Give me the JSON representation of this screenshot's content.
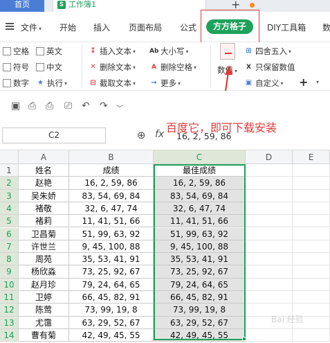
{
  "titlebar": {
    "home_tab": "首页",
    "book_icon_letter": "S",
    "book_name": "工作簿1",
    "new_tab": "+"
  },
  "menubar": {
    "file": "文件",
    "start": "开始",
    "insert": "插入",
    "page_layout": "页面布局",
    "formulas": "公式",
    "fangfang": "方方格子",
    "diy": "DIY工具箱",
    "data": "数"
  },
  "ribbon": {
    "chk_space": "空格",
    "chk_english": "英文",
    "chk_symbol": "符号",
    "chk_chinese": "中文",
    "chk_number": "数字",
    "execute": "执行",
    "insert_text": "插入文本",
    "delete_text": "删除文本",
    "cut_text": "截取文本",
    "case": "大小写",
    "delete_space": "删除空格",
    "more": "更多",
    "numeric": "数值",
    "round": "四舍五入",
    "keep_values": "只保留数值",
    "custom": "自定义",
    "plus": "+"
  },
  "formula": {
    "cell_ref": "C2",
    "value": "16, 2, 59, 86"
  },
  "annotation": "百度它，即可下载安装",
  "sheet": {
    "columns": [
      "A",
      "B",
      "C",
      "D",
      "E"
    ],
    "headers": [
      "姓名",
      "成绩",
      "最佳成绩"
    ],
    "rows": [
      {
        "n": "2",
        "name": "赵艳",
        "score": "16, 2, 59, 86",
        "best": "16, 2, 59, 86"
      },
      {
        "n": "3",
        "name": "吴朱娇",
        "score": "83, 54, 69, 84",
        "best": "83, 54, 69, 84"
      },
      {
        "n": "4",
        "name": "褚敬",
        "score": "32, 6, 47, 74",
        "best": "32, 6, 47, 74"
      },
      {
        "n": "5",
        "name": "褚莉",
        "score": "11, 41, 51, 66",
        "best": "11, 41, 51, 66"
      },
      {
        "n": "6",
        "name": "卫昌菊",
        "score": "51, 99, 63, 92",
        "best": "51, 99, 63, 92"
      },
      {
        "n": "7",
        "name": "许世兰",
        "score": "9, 45, 100, 88",
        "best": "9, 45, 100, 88"
      },
      {
        "n": "8",
        "name": "周苑",
        "score": "35, 53, 41, 91",
        "best": "35, 53, 41, 91"
      },
      {
        "n": "9",
        "name": "杨欣淼",
        "score": "73, 25, 92, 67",
        "best": "73, 25, 92, 67"
      },
      {
        "n": "10",
        "name": "赵月珍",
        "score": "79, 24, 64, 65",
        "best": "79, 24, 64, 65"
      },
      {
        "n": "11",
        "name": "卫婷",
        "score": "66, 45, 82, 91",
        "best": "66, 45, 82, 91"
      },
      {
        "n": "12",
        "name": "陈莺",
        "score": "73, 99, 19, 8",
        "best": "73, 99, 19, 8"
      },
      {
        "n": "13",
        "name": "尤霭",
        "score": "63, 29, 52, 67",
        "best": "63, 29, 52, 67"
      },
      {
        "n": "14",
        "name": "曹有菊",
        "score": "42, 49, 45, 55",
        "best": "42, 49, 45, 55"
      }
    ]
  },
  "watermark": "Bai 经验",
  "colors": {
    "accent_green": "#1ea15a",
    "annotation_red": "#e03a3a",
    "home_tab_blue": "#4a7dd6"
  }
}
